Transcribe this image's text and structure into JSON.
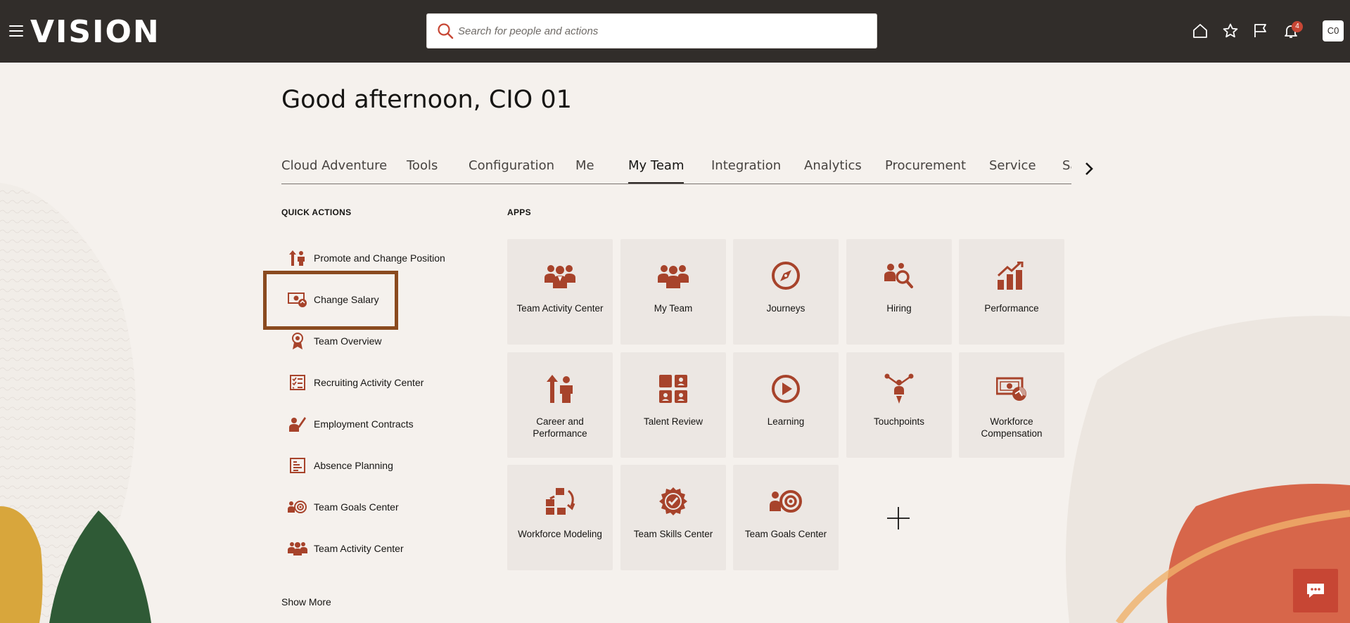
{
  "colors": {
    "header_bg": "#312d2a",
    "accent": "#a7432b",
    "page_bg": "#f5f1ed",
    "tile_bg": "#ece7e3",
    "highlight": "#8a4a1f"
  },
  "header": {
    "logo": "VISION",
    "search_placeholder": "Search for people and actions",
    "notification_count": "4",
    "avatar_initials": "C0",
    "icons": [
      "menu-icon",
      "home-icon",
      "star-icon",
      "flag-icon",
      "bell-icon"
    ]
  },
  "greeting": "Good afternoon, CIO 01",
  "tabs": [
    {
      "label": "Cloud Adventure"
    },
    {
      "label": "Tools"
    },
    {
      "label": "Configuration"
    },
    {
      "label": "Me"
    },
    {
      "label": "My Team",
      "active": true
    },
    {
      "label": "Integration"
    },
    {
      "label": "Analytics"
    },
    {
      "label": "Procurement"
    },
    {
      "label": "Service"
    },
    {
      "label": "Sales"
    }
  ],
  "quick_actions": {
    "title": "QUICK ACTIONS",
    "items": [
      {
        "label": "Promote and Change Position",
        "icon": "promote-icon"
      },
      {
        "label": "Change Salary",
        "icon": "salary-icon",
        "highlighted": true
      },
      {
        "label": "Team Overview",
        "icon": "badge-icon"
      },
      {
        "label": "Recruiting Activity Center",
        "icon": "checklist-icon"
      },
      {
        "label": "Employment Contracts",
        "icon": "contract-icon"
      },
      {
        "label": "Absence Planning",
        "icon": "calendar-icon"
      },
      {
        "label": "Team Goals Center",
        "icon": "goals-icon"
      },
      {
        "label": "Team Activity Center",
        "icon": "team-icon"
      }
    ],
    "show_more": "Show More"
  },
  "apps": {
    "title": "APPS",
    "items": [
      {
        "label": "Team Activity Center",
        "icon": "team-icon"
      },
      {
        "label": "My Team",
        "icon": "team-icon"
      },
      {
        "label": "Journeys",
        "icon": "compass-icon"
      },
      {
        "label": "Hiring",
        "icon": "hiring-icon"
      },
      {
        "label": "Performance",
        "icon": "chart-icon"
      },
      {
        "label": "Career and Performance",
        "icon": "promote-icon"
      },
      {
        "label": "Talent Review",
        "icon": "grid-people-icon"
      },
      {
        "label": "Learning",
        "icon": "play-icon"
      },
      {
        "label": "Touchpoints",
        "icon": "touchpoints-icon"
      },
      {
        "label": "Workforce Compensation",
        "icon": "salary-icon"
      },
      {
        "label": "Workforce Modeling",
        "icon": "modeling-icon"
      },
      {
        "label": "Team Skills Center",
        "icon": "seal-check-icon"
      },
      {
        "label": "Team Goals Center",
        "icon": "goals-icon"
      }
    ]
  }
}
